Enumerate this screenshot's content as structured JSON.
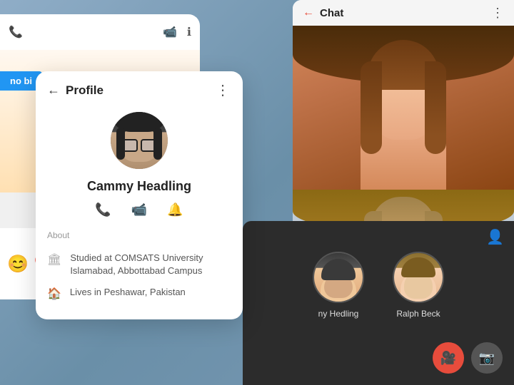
{
  "background": {
    "color": "#7a9ab5"
  },
  "chat_screen": {
    "title": "Chat",
    "back_icon": "←",
    "more_icon": "⋮"
  },
  "video_call_screen": {
    "user_icon": "👤",
    "avatars": [
      {
        "name": "ny Hedling"
      },
      {
        "name": "Ralph Beck"
      }
    ],
    "controls": [
      {
        "icon": "📷",
        "type": "camera"
      },
      {
        "icon": "📸",
        "type": "snapshot"
      }
    ]
  },
  "main_card": {
    "phone_icon": "📞",
    "video_icon": "📹",
    "info_icon": "ℹ",
    "blue_label": "no bi"
  },
  "profile_card": {
    "title": "Profile",
    "back_arrow": "←",
    "more_icon": "⋮",
    "name": "Cammy Headling",
    "about_label": "About",
    "phone_icon": "📞",
    "video_icon": "📹",
    "notification_icon": "🔔",
    "info_rows": [
      {
        "icon": "🏛",
        "text": "Studied at COMSATS University Islamabad, Abbottabad Campus"
      },
      {
        "icon": "🏠",
        "text": "Lives in Peshawar, Pakistan"
      }
    ]
  }
}
